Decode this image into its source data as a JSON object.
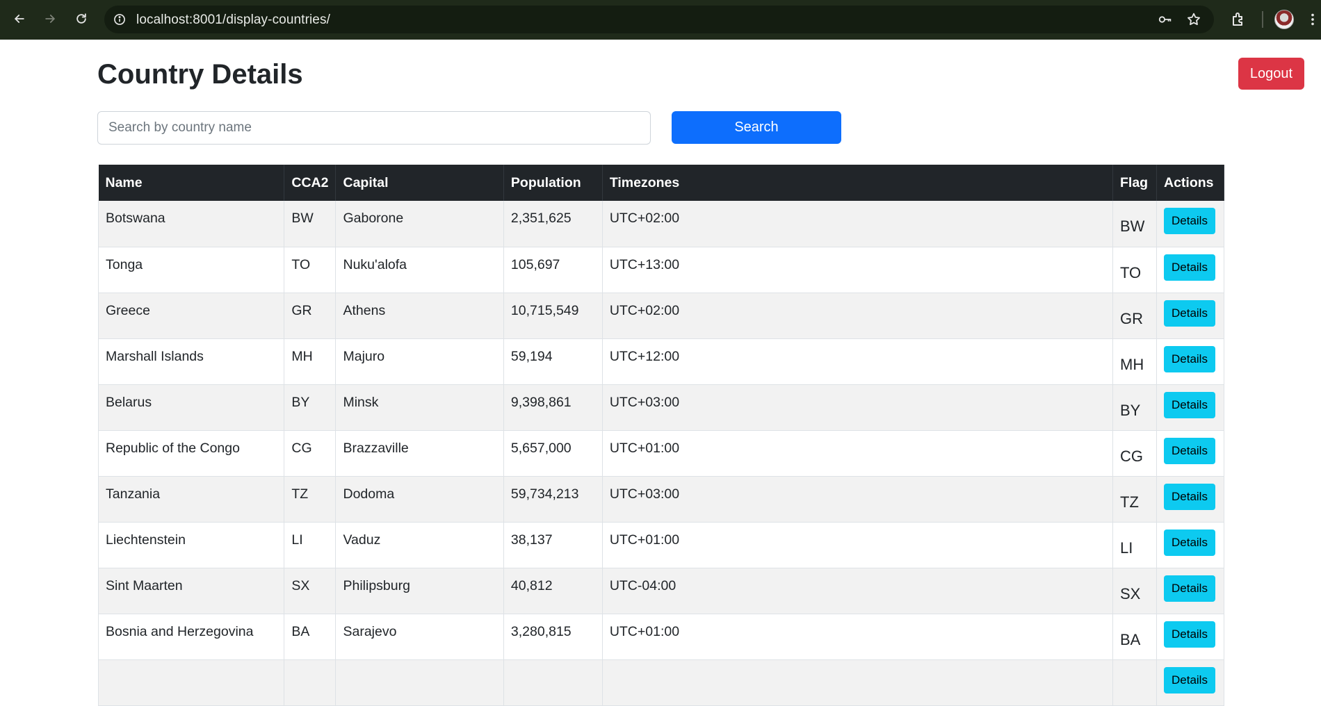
{
  "browser": {
    "url": "localhost:8001/display-countries/"
  },
  "page": {
    "title": "Country Details",
    "logout_label": "Logout",
    "search_placeholder": "Search by country name",
    "search_value": "",
    "search_label": "Search"
  },
  "table": {
    "headers": [
      "Name",
      "CCA2",
      "Capital",
      "Population",
      "Timezones",
      "Flag",
      "Actions"
    ],
    "details_label": "Details",
    "rows": [
      {
        "name": "Botswana",
        "cca2": "BW",
        "capital": "Gaborone",
        "population": "2,351,625",
        "timezones": "UTC+02:00",
        "flag": "BW"
      },
      {
        "name": "Tonga",
        "cca2": "TO",
        "capital": "Nuku'alofa",
        "population": "105,697",
        "timezones": "UTC+13:00",
        "flag": "TO"
      },
      {
        "name": "Greece",
        "cca2": "GR",
        "capital": "Athens",
        "population": "10,715,549",
        "timezones": "UTC+02:00",
        "flag": "GR"
      },
      {
        "name": "Marshall Islands",
        "cca2": "MH",
        "capital": "Majuro",
        "population": "59,194",
        "timezones": "UTC+12:00",
        "flag": "MH"
      },
      {
        "name": "Belarus",
        "cca2": "BY",
        "capital": "Minsk",
        "population": "9,398,861",
        "timezones": "UTC+03:00",
        "flag": "BY"
      },
      {
        "name": "Republic of the Congo",
        "cca2": "CG",
        "capital": "Brazzaville",
        "population": "5,657,000",
        "timezones": "UTC+01:00",
        "flag": "CG"
      },
      {
        "name": "Tanzania",
        "cca2": "TZ",
        "capital": "Dodoma",
        "population": "59,734,213",
        "timezones": "UTC+03:00",
        "flag": "TZ"
      },
      {
        "name": "Liechtenstein",
        "cca2": "LI",
        "capital": "Vaduz",
        "population": "38,137",
        "timezones": "UTC+01:00",
        "flag": "LI"
      },
      {
        "name": "Sint Maarten",
        "cca2": "SX",
        "capital": "Philipsburg",
        "population": "40,812",
        "timezones": "UTC-04:00",
        "flag": "SX"
      },
      {
        "name": "Bosnia and Herzegovina",
        "cca2": "BA",
        "capital": "Sarajevo",
        "population": "3,280,815",
        "timezones": "UTC+01:00",
        "flag": "BA"
      },
      {
        "name": "",
        "cca2": "",
        "capital": "",
        "population": "",
        "timezones": "",
        "flag": ""
      }
    ]
  }
}
